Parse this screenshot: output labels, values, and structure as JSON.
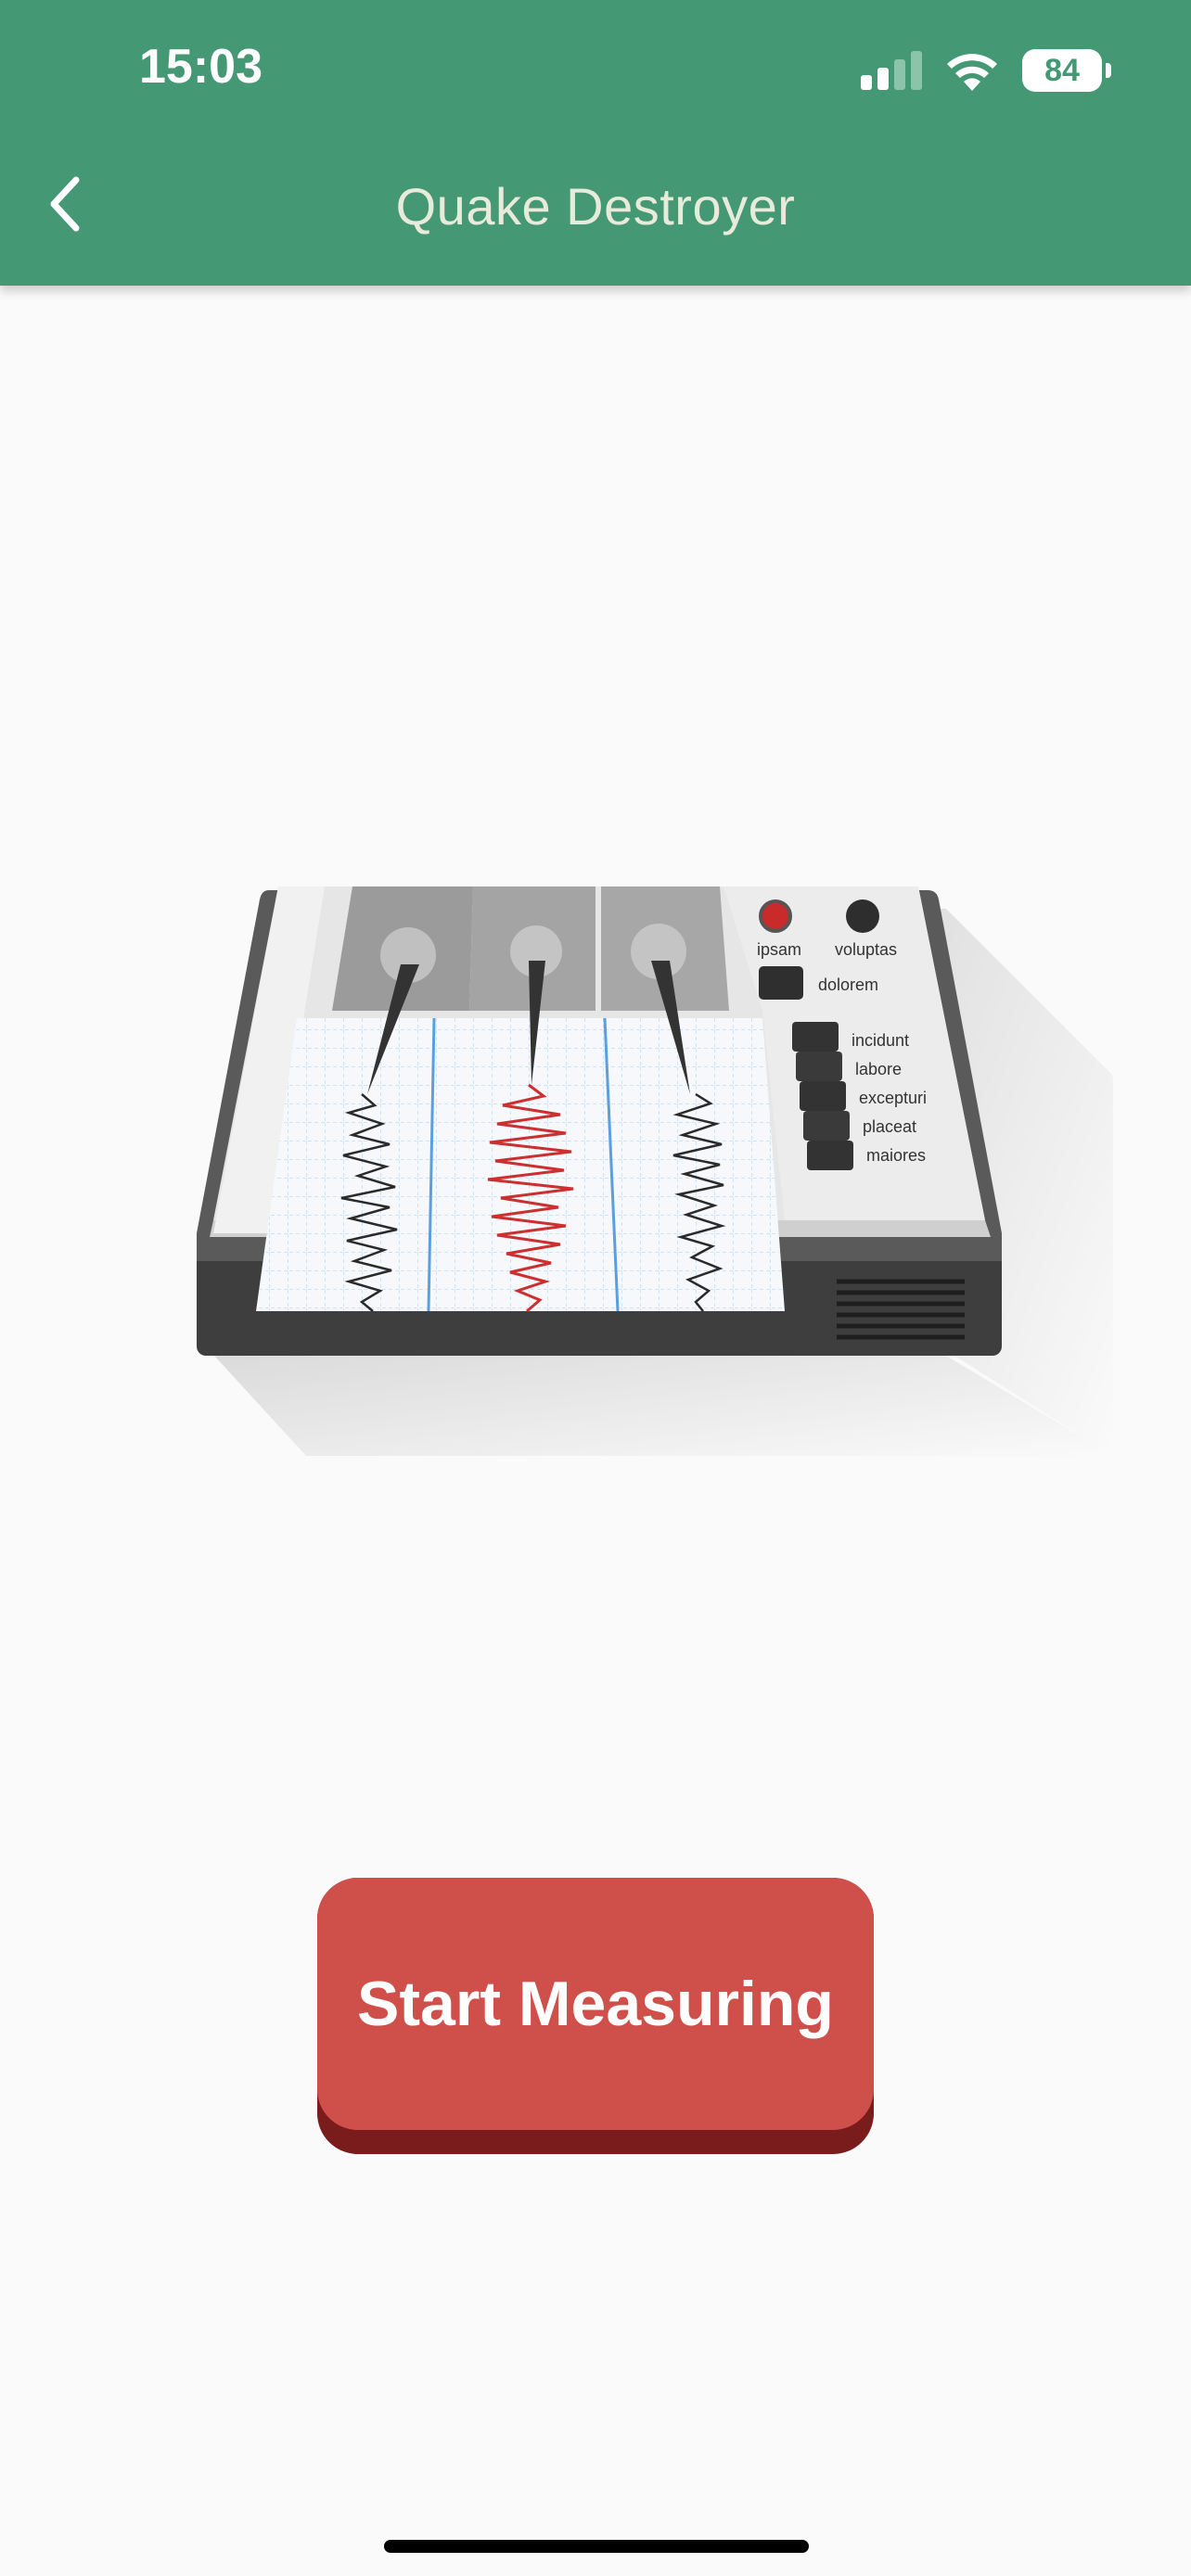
{
  "status_bar": {
    "time": "15:03",
    "battery_level": "84",
    "icons": [
      "cellular-signal-icon",
      "wifi-icon",
      "battery-icon"
    ]
  },
  "header": {
    "title": "Quake Destroyer",
    "back_icon": "chevron-left-icon",
    "background_color": "#449874"
  },
  "illustration": {
    "name": "seismograph",
    "indicator_labels": [
      "ipsam",
      "voluptas"
    ],
    "button_label": "dolorem",
    "switch_labels": [
      "incidunt",
      "labore",
      "excepturi",
      "placeat",
      "maiores"
    ]
  },
  "actions": {
    "start_label": "Start Measuring",
    "button_color": "#cf504b"
  }
}
